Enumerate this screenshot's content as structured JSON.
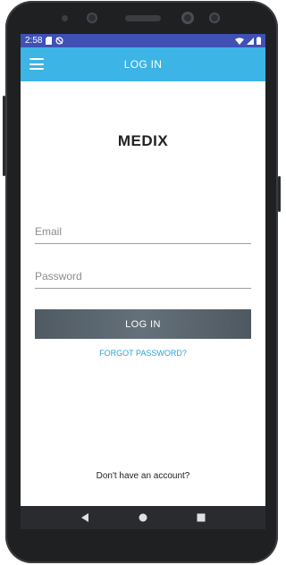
{
  "status_bar": {
    "time": "2:58",
    "icons": [
      "sd-card-icon",
      "sync-off-icon",
      "wifi-icon",
      "signal-icon",
      "battery-icon"
    ]
  },
  "app_bar": {
    "title": "LOG IN",
    "menu_icon": "hamburger-menu-icon",
    "color": "#3cb4e5"
  },
  "brand": {
    "name": "MEDIX"
  },
  "form": {
    "email": {
      "placeholder": "Email",
      "value": ""
    },
    "password": {
      "placeholder": "Password",
      "value": ""
    },
    "login_button": "LOG IN",
    "forgot_password": "FORGOT PASSWORD?"
  },
  "footer": {
    "signup_text": "Don't have an account?"
  },
  "nav_bar": {
    "back_icon": "back-triangle-icon",
    "home_icon": "home-circle-icon",
    "recents_icon": "recents-square-icon"
  },
  "colors": {
    "status_bar": "#3f51b5",
    "accent": "#3cb4e5",
    "link": "#29a3d9",
    "button": "#5a656e"
  }
}
